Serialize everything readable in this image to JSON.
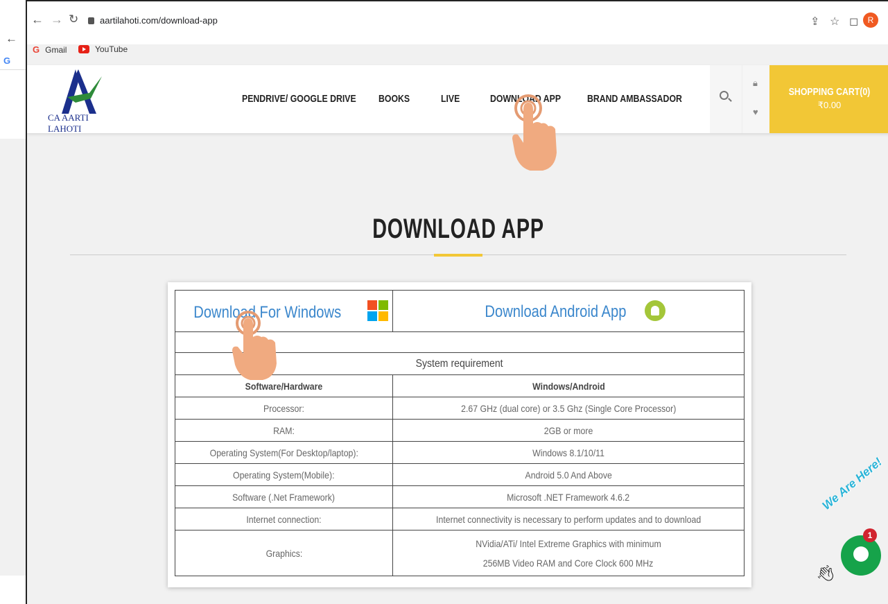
{
  "browser": {
    "url": "aartilahoti.com/download-app",
    "avatar_letter": "R",
    "bookmarks": [
      {
        "label": "Gmail",
        "icon": "gmail-icon"
      },
      {
        "label": "YouTube",
        "icon": "youtube-icon"
      }
    ]
  },
  "site": {
    "logo_text": "CA AARTI LAHOTI",
    "nav": [
      {
        "label": "PENDRIVE/ GOOGLE DRIVE"
      },
      {
        "label": "BOOKS"
      },
      {
        "label": "LIVE"
      },
      {
        "label": "DOWNLOAD APP"
      },
      {
        "label": "BRAND AMBASSADOR"
      }
    ],
    "cart": {
      "title": "SHOPPING CART(0)",
      "price": "₹0.00"
    },
    "colors": {
      "accent": "#f2c736",
      "link": "#3b87cc"
    }
  },
  "main": {
    "title": "DOWNLOAD APP",
    "download_windows": "Download For Windows",
    "download_android": "Download Android App",
    "sys_req_title": "System requirement",
    "table_header": [
      "Software/Hardware",
      "Windows/Android"
    ],
    "rows": [
      [
        "Processor:",
        "2.67 GHz (dual core) or 3.5 Ghz (Single Core Processor)"
      ],
      [
        "RAM:",
        "2GB or more"
      ],
      [
        "Operating System(For Desktop/laptop):",
        "Windows 8.1/10/11"
      ],
      [
        "Operating System(Mobile):",
        "Android 5.0 And Above"
      ],
      [
        "Software (.Net Framework)",
        "Microsoft .NET Framework 4.6.2"
      ],
      [
        "Internet connection:",
        "Internet connectivity is necessary to perform updates and to download"
      ]
    ],
    "graphics_label": "Graphics:",
    "graphics_line1": "NVidia/ATi/ Intel Extreme Graphics with minimum",
    "graphics_line2": "256MB Video RAM and Core Clock 600 MHz"
  },
  "chat": {
    "badge": "1",
    "text": "We Are Here!"
  }
}
